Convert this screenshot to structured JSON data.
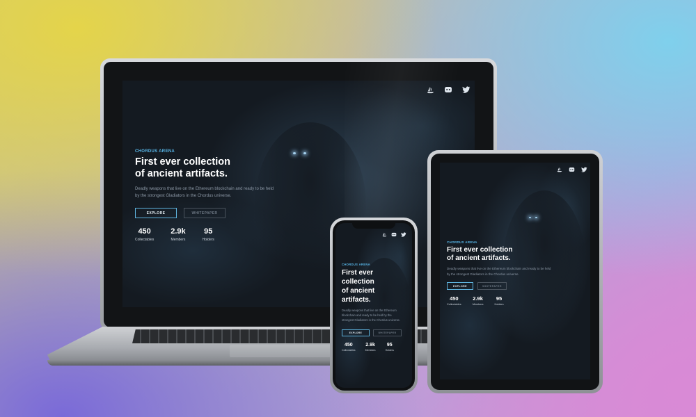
{
  "site": {
    "kicker": "CHORDUS ARENA",
    "title_line1": "First ever collection",
    "title_line2": "of ancient artifacts.",
    "description": "Deadly weapons that live on the Ethereum blockchain and ready to be held by the strongest Gladiators in the Chordus universe.",
    "buttons": {
      "explore": "EXPLORE",
      "whitepaper": "WHITEPAPER"
    },
    "stats": [
      {
        "value": "450",
        "label": "Collectables"
      },
      {
        "value": "2.9k",
        "label": "Members"
      },
      {
        "value": "95",
        "label": "Holders"
      }
    ],
    "social_icons": [
      "opensea-icon",
      "discord-icon",
      "twitter-icon"
    ]
  },
  "phone_title": [
    "First ever",
    "collection",
    "of ancient",
    "artifacts."
  ],
  "colors": {
    "accent": "#58b6e8",
    "screen_bg": "#141a21",
    "text_muted": "#8c98a6"
  }
}
